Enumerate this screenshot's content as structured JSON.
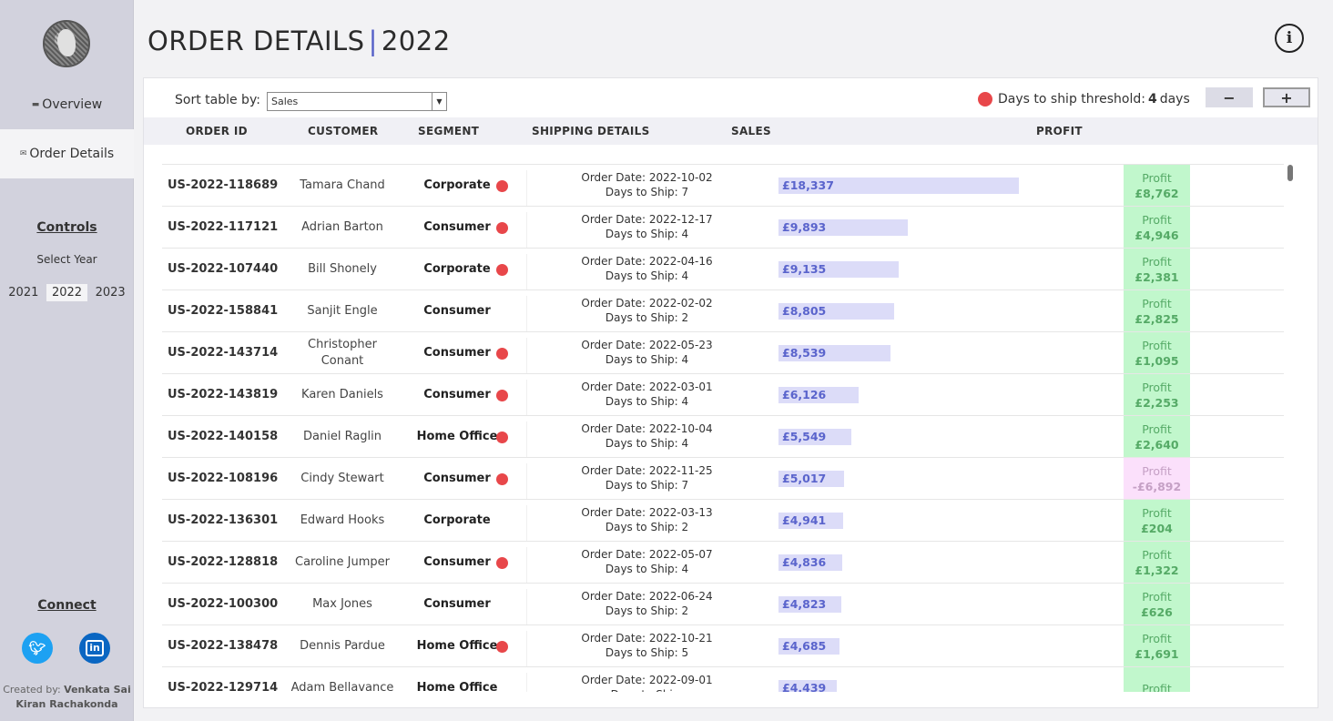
{
  "sidebar": {
    "logo_icon": "globe-icon",
    "nav": [
      {
        "label": "Overview",
        "icon": "dashboard-icon",
        "active": false
      },
      {
        "label": "Order Details",
        "icon": "mail-icon",
        "active": true
      }
    ],
    "controls_heading": "Controls",
    "select_year_label": "Select Year",
    "years": [
      "2021",
      "2022",
      "2023"
    ],
    "selected_year": "2022",
    "connect_heading": "Connect",
    "credit_prefix": "Created by:",
    "credit_name": "Venkata Sai Kiran Rachakonda"
  },
  "header": {
    "title": "ORDER DETAILS",
    "separator": "|",
    "year": "2022"
  },
  "toolbar": {
    "sort_label": "Sort table by:",
    "sort_value": "Sales",
    "threshold_label": "Days to ship threshold:",
    "threshold_value": "4",
    "threshold_unit": "days",
    "minus_label": "−",
    "plus_label": "+"
  },
  "columns": [
    "ORDER ID",
    "CUSTOMER",
    "SEGMENT",
    "SHIPPING DETAILS",
    "SALES",
    "PROFIT"
  ],
  "colors": {
    "accent": "#5560c8",
    "late_dot": "#e8474a",
    "sales_bar": "#dcdcf8",
    "profit_positive": "#c1f7cc",
    "profit_negative": "#fbe0fb"
  },
  "max_sales": 18337,
  "rows": [
    {
      "id": "US-2022-118689",
      "customer": "Tamara Chand",
      "segment": "Corporate",
      "late": true,
      "order_date": "2022-10-02",
      "days": "7",
      "sales": "£18,337",
      "sales_value": 18337,
      "profit": "£8,762",
      "profit_negative": false
    },
    {
      "id": "US-2022-117121",
      "customer": "Adrian Barton",
      "segment": "Consumer",
      "late": true,
      "order_date": "2022-12-17",
      "days": "4",
      "sales": "£9,893",
      "sales_value": 9893,
      "profit": "£4,946",
      "profit_negative": false
    },
    {
      "id": "US-2022-107440",
      "customer": "Bill Shonely",
      "segment": "Corporate",
      "late": true,
      "order_date": "2022-04-16",
      "days": "4",
      "sales": "£9,135",
      "sales_value": 9135,
      "profit": "£2,381",
      "profit_negative": false
    },
    {
      "id": "US-2022-158841",
      "customer": "Sanjit Engle",
      "segment": "Consumer",
      "late": false,
      "order_date": "2022-02-02",
      "days": "2",
      "sales": "£8,805",
      "sales_value": 8805,
      "profit": "£2,825",
      "profit_negative": false
    },
    {
      "id": "US-2022-143714",
      "customer": "Christopher Conant",
      "segment": "Consumer",
      "late": true,
      "order_date": "2022-05-23",
      "days": "4",
      "sales": "£8,539",
      "sales_value": 8539,
      "profit": "£1,095",
      "profit_negative": false
    },
    {
      "id": "US-2022-143819",
      "customer": "Karen Daniels",
      "segment": "Consumer",
      "late": true,
      "order_date": "2022-03-01",
      "days": "4",
      "sales": "£6,126",
      "sales_value": 6126,
      "profit": "£2,253",
      "profit_negative": false
    },
    {
      "id": "US-2022-140158",
      "customer": "Daniel Raglin",
      "segment": "Home Office",
      "late": true,
      "order_date": "2022-10-04",
      "days": "4",
      "sales": "£5,549",
      "sales_value": 5549,
      "profit": "£2,640",
      "profit_negative": false
    },
    {
      "id": "US-2022-108196",
      "customer": "Cindy Stewart",
      "segment": "Consumer",
      "late": true,
      "order_date": "2022-11-25",
      "days": "7",
      "sales": "£5,017",
      "sales_value": 5017,
      "profit": "-£6,892",
      "profit_negative": true
    },
    {
      "id": "US-2022-136301",
      "customer": "Edward Hooks",
      "segment": "Corporate",
      "late": false,
      "order_date": "2022-03-13",
      "days": "2",
      "sales": "£4,941",
      "sales_value": 4941,
      "profit": "£204",
      "profit_negative": false
    },
    {
      "id": "US-2022-128818",
      "customer": "Caroline Jumper",
      "segment": "Consumer",
      "late": true,
      "order_date": "2022-05-07",
      "days": "4",
      "sales": "£4,836",
      "sales_value": 4836,
      "profit": "£1,322",
      "profit_negative": false
    },
    {
      "id": "US-2022-100300",
      "customer": "Max Jones",
      "segment": "Consumer",
      "late": false,
      "order_date": "2022-06-24",
      "days": "2",
      "sales": "£4,823",
      "sales_value": 4823,
      "profit": "£626",
      "profit_negative": false
    },
    {
      "id": "US-2022-138478",
      "customer": "Dennis Pardue",
      "segment": "Home Office",
      "late": true,
      "order_date": "2022-10-21",
      "days": "5",
      "sales": "£4,685",
      "sales_value": 4685,
      "profit": "£1,691",
      "profit_negative": false
    },
    {
      "id": "US-2022-129714",
      "customer": "Adam Bellavance",
      "segment": "Home Office",
      "late": false,
      "order_date": "2022-09-01",
      "days": "",
      "sales": "£4,439",
      "sales_value": 4439,
      "profit": "",
      "profit_negative": false
    }
  ],
  "labels": {
    "order_date_prefix": "Order Date:",
    "days_prefix": "Days to Ship:",
    "profit_label": "Profit"
  }
}
